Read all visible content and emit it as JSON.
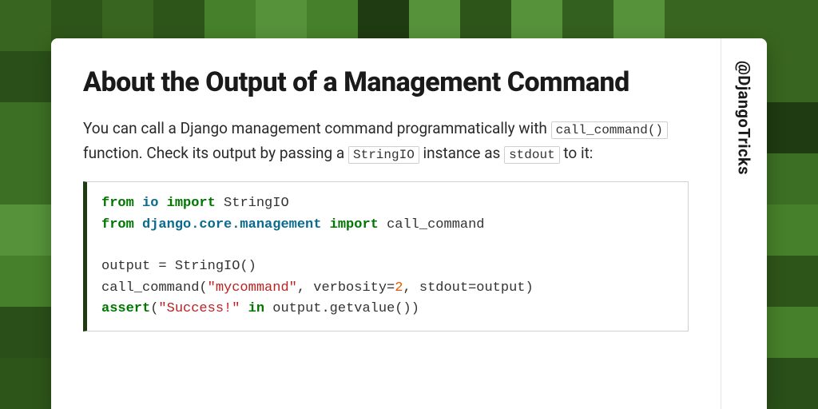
{
  "handle": "@DjangoTricks",
  "title": "About the Output of a Management Command",
  "lead": {
    "pre": "You can call a Django management command programmatically with ",
    "ic1": "call_command()",
    "mid1": " function. Check its output by passing a ",
    "ic2": "StringIO",
    "mid2": " instance as ",
    "ic3": "stdout",
    "post": " to it:"
  },
  "code": {
    "kw_from": "from",
    "kw_import": "import",
    "kw_assert": "assert",
    "kw_in": "in",
    "mod_io": "io",
    "mod_django": "django.core.management",
    "id_StringIO": " StringIO",
    "id_call_command": " call_command",
    "line3": "output = StringIO()",
    "l4_pre": "call_command(",
    "l4_str": "\"mycommand\"",
    "l4_mid": ", verbosity=",
    "l4_num": "2",
    "l4_post": ", stdout=output)",
    "l5_pre": "(",
    "l5_str": "\"Success!\"",
    "l5_post": " output.getvalue())"
  },
  "bg_palette": [
    "#1f3b12",
    "#2a4f18",
    "#33601e",
    "#3c6f24",
    "#46802a",
    "#55923a",
    "#2e5519",
    "#38651f"
  ]
}
